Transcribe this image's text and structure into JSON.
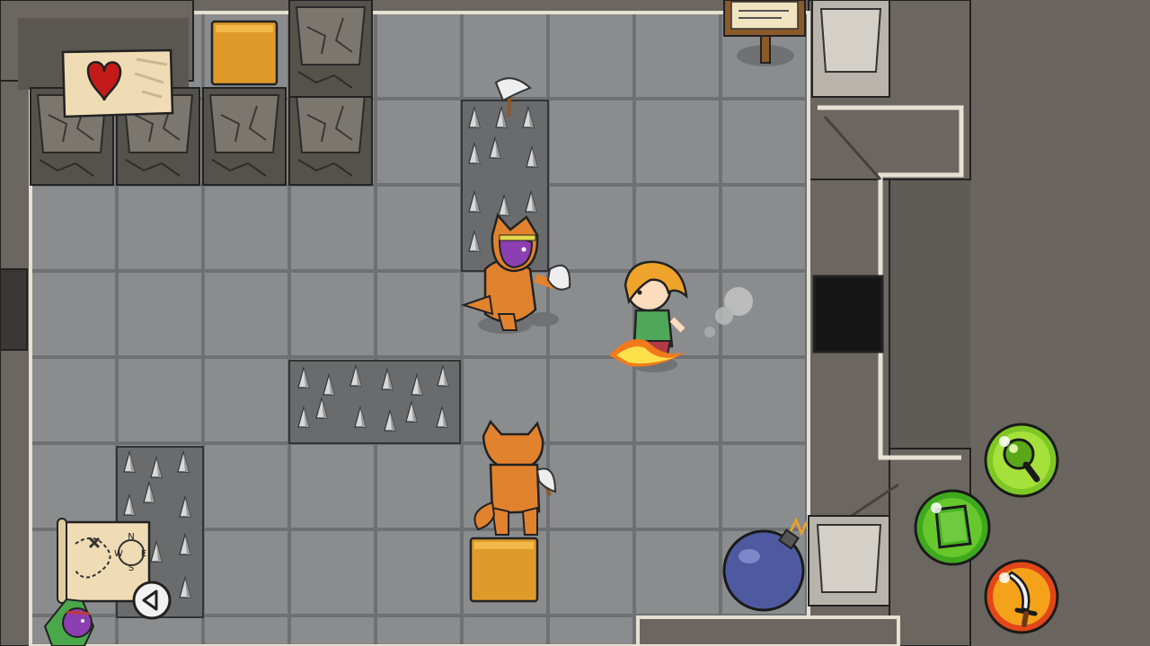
{
  "scene": {
    "name": "dungeon-room",
    "floor_color": "#8a8c8e",
    "wall_color": "#6b6760",
    "outside_color": "#5f5b55"
  },
  "hud": {
    "health": {
      "icon": "heart-icon",
      "accent": "#c41a1a"
    },
    "map_button": {
      "icon": "treasure-map-icon",
      "compass_letters": [
        "N",
        "W",
        "E",
        "S"
      ]
    },
    "back_button": {
      "icon": "back-arrow-icon"
    },
    "actions": [
      {
        "id": "magnify",
        "icon": "magnifying-glass-icon",
        "color": "#7ec825"
      },
      {
        "id": "block",
        "icon": "green-block-icon",
        "color": "#3fa91e"
      },
      {
        "id": "sword",
        "icon": "sword-icon",
        "color": "#e2461a"
      }
    ]
  },
  "characters": {
    "player": {
      "name": "hero",
      "hair": "#f0a32a",
      "shirt": "#4fa85a"
    },
    "enemies": [
      {
        "name": "fox-costume-goblin",
        "skin": "#8b3fb0",
        "costume": "#e1822e"
      },
      {
        "name": "fox-axe-enemy",
        "costume": "#e1822e"
      }
    ],
    "companion": {
      "name": "goblin-companion"
    }
  },
  "objects": {
    "sign": "wooden-sign",
    "bomb": "bomb",
    "crates": [
      "orange-pressure-plate",
      "orange-pressure-plate"
    ]
  }
}
